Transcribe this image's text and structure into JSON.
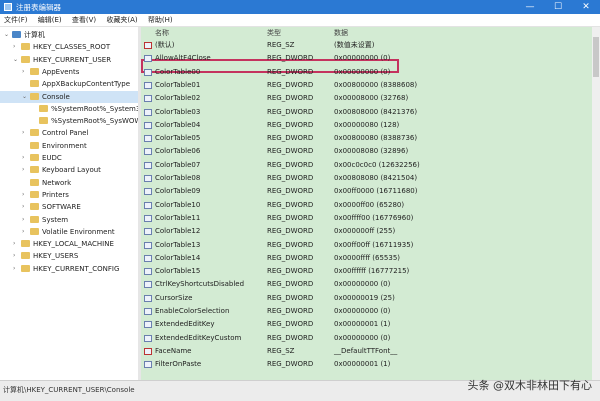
{
  "window": {
    "title": "注册表编辑器",
    "minimize": "—",
    "maximize": "☐",
    "close": "✕"
  },
  "menu": [
    "文件(F)",
    "编辑(E)",
    "查看(V)",
    "收藏夹(A)",
    "帮助(H)"
  ],
  "tree": [
    {
      "label": "计算机",
      "depth": 0,
      "twisty": "⌄",
      "icon": "computer-icon"
    },
    {
      "label": "HKEY_CLASSES_ROOT",
      "depth": 1,
      "twisty": "›",
      "icon": "folder-icon"
    },
    {
      "label": "HKEY_CURRENT_USER",
      "depth": 1,
      "twisty": "⌄",
      "icon": "folder-icon"
    },
    {
      "label": "AppEvents",
      "depth": 2,
      "twisty": "›",
      "icon": "folder-icon"
    },
    {
      "label": "AppXBackupContentType",
      "depth": 2,
      "twisty": "",
      "icon": "folder-icon"
    },
    {
      "label": "Console",
      "depth": 2,
      "twisty": "⌄",
      "icon": "folder-icon",
      "selected": true
    },
    {
      "label": "%SystemRoot%_System32",
      "depth": 3,
      "twisty": "",
      "icon": "folder-icon"
    },
    {
      "label": "%SystemRoot%_SysWOW",
      "depth": 3,
      "twisty": "",
      "icon": "folder-icon"
    },
    {
      "label": "Control Panel",
      "depth": 2,
      "twisty": "›",
      "icon": "folder-icon"
    },
    {
      "label": "Environment",
      "depth": 2,
      "twisty": "",
      "icon": "folder-icon"
    },
    {
      "label": "EUDC",
      "depth": 2,
      "twisty": "›",
      "icon": "folder-icon"
    },
    {
      "label": "Keyboard Layout",
      "depth": 2,
      "twisty": "›",
      "icon": "folder-icon"
    },
    {
      "label": "Network",
      "depth": 2,
      "twisty": "",
      "icon": "folder-icon"
    },
    {
      "label": "Printers",
      "depth": 2,
      "twisty": "›",
      "icon": "folder-icon"
    },
    {
      "label": "SOFTWARE",
      "depth": 2,
      "twisty": "›",
      "icon": "folder-icon"
    },
    {
      "label": "System",
      "depth": 2,
      "twisty": "›",
      "icon": "folder-icon"
    },
    {
      "label": "Volatile Environment",
      "depth": 2,
      "twisty": "›",
      "icon": "folder-icon"
    },
    {
      "label": "HKEY_LOCAL_MACHINE",
      "depth": 1,
      "twisty": "›",
      "icon": "folder-icon"
    },
    {
      "label": "HKEY_USERS",
      "depth": 1,
      "twisty": "›",
      "icon": "folder-icon"
    },
    {
      "label": "HKEY_CURRENT_CONFIG",
      "depth": 1,
      "twisty": "›",
      "icon": "folder-icon"
    }
  ],
  "columns": {
    "name": "名称",
    "type": "类型",
    "data": "数据"
  },
  "values": [
    {
      "name": "(默认)",
      "type": "REG_SZ",
      "data": "(数值未设置)",
      "icon": "ab"
    },
    {
      "name": "AllowAltF4Close",
      "type": "REG_DWORD",
      "data": "0x00000000 (0)",
      "icon": "bin"
    },
    {
      "name": "ColorTable00",
      "type": "REG_DWORD",
      "data": "0x00000000 (0)",
      "icon": "bin"
    },
    {
      "name": "ColorTable01",
      "type": "REG_DWORD",
      "data": "0x00800000 (8388608)",
      "icon": "bin"
    },
    {
      "name": "ColorTable02",
      "type": "REG_DWORD",
      "data": "0x00008000 (32768)",
      "icon": "bin"
    },
    {
      "name": "ColorTable03",
      "type": "REG_DWORD",
      "data": "0x00808000 (8421376)",
      "icon": "bin"
    },
    {
      "name": "ColorTable04",
      "type": "REG_DWORD",
      "data": "0x00000080 (128)",
      "icon": "bin"
    },
    {
      "name": "ColorTable05",
      "type": "REG_DWORD",
      "data": "0x00800080 (8388736)",
      "icon": "bin"
    },
    {
      "name": "ColorTable06",
      "type": "REG_DWORD",
      "data": "0x00008080 (32896)",
      "icon": "bin"
    },
    {
      "name": "ColorTable07",
      "type": "REG_DWORD",
      "data": "0x00c0c0c0 (12632256)",
      "icon": "bin"
    },
    {
      "name": "ColorTable08",
      "type": "REG_DWORD",
      "data": "0x00808080 (8421504)",
      "icon": "bin"
    },
    {
      "name": "ColorTable09",
      "type": "REG_DWORD",
      "data": "0x00ff0000 (16711680)",
      "icon": "bin"
    },
    {
      "name": "ColorTable10",
      "type": "REG_DWORD",
      "data": "0x0000ff00 (65280)",
      "icon": "bin"
    },
    {
      "name": "ColorTable11",
      "type": "REG_DWORD",
      "data": "0x00ffff00 (16776960)",
      "icon": "bin"
    },
    {
      "name": "ColorTable12",
      "type": "REG_DWORD",
      "data": "0x000000ff (255)",
      "icon": "bin"
    },
    {
      "name": "ColorTable13",
      "type": "REG_DWORD",
      "data": "0x00ff00ff (16711935)",
      "icon": "bin"
    },
    {
      "name": "ColorTable14",
      "type": "REG_DWORD",
      "data": "0x0000ffff (65535)",
      "icon": "bin"
    },
    {
      "name": "ColorTable15",
      "type": "REG_DWORD",
      "data": "0x00ffffff (16777215)",
      "icon": "bin"
    },
    {
      "name": "CtrlKeyShortcutsDisabled",
      "type": "REG_DWORD",
      "data": "0x00000000 (0)",
      "icon": "bin"
    },
    {
      "name": "CursorSize",
      "type": "REG_DWORD",
      "data": "0x00000019 (25)",
      "icon": "bin"
    },
    {
      "name": "EnableColorSelection",
      "type": "REG_DWORD",
      "data": "0x00000000 (0)",
      "icon": "bin"
    },
    {
      "name": "ExtendedEditKey",
      "type": "REG_DWORD",
      "data": "0x00000001 (1)",
      "icon": "bin"
    },
    {
      "name": "ExtendedEditKeyCustom",
      "type": "REG_DWORD",
      "data": "0x00000000 (0)",
      "icon": "bin"
    },
    {
      "name": "FaceName",
      "type": "REG_SZ",
      "data": "__DefaultTTFont__",
      "icon": "ab"
    },
    {
      "name": "FilterOnPaste",
      "type": "REG_DWORD",
      "data": "0x00000001 (1)",
      "icon": "bin"
    }
  ],
  "status": {
    "path": "计算机\\HKEY_CURRENT_USER\\Console"
  },
  "watermark": "头条 @双木非林田下有心",
  "colors": {
    "titlebar": "#2b79d3",
    "values_bg": "#d3ebd3",
    "highlight": "#c4335e"
  }
}
